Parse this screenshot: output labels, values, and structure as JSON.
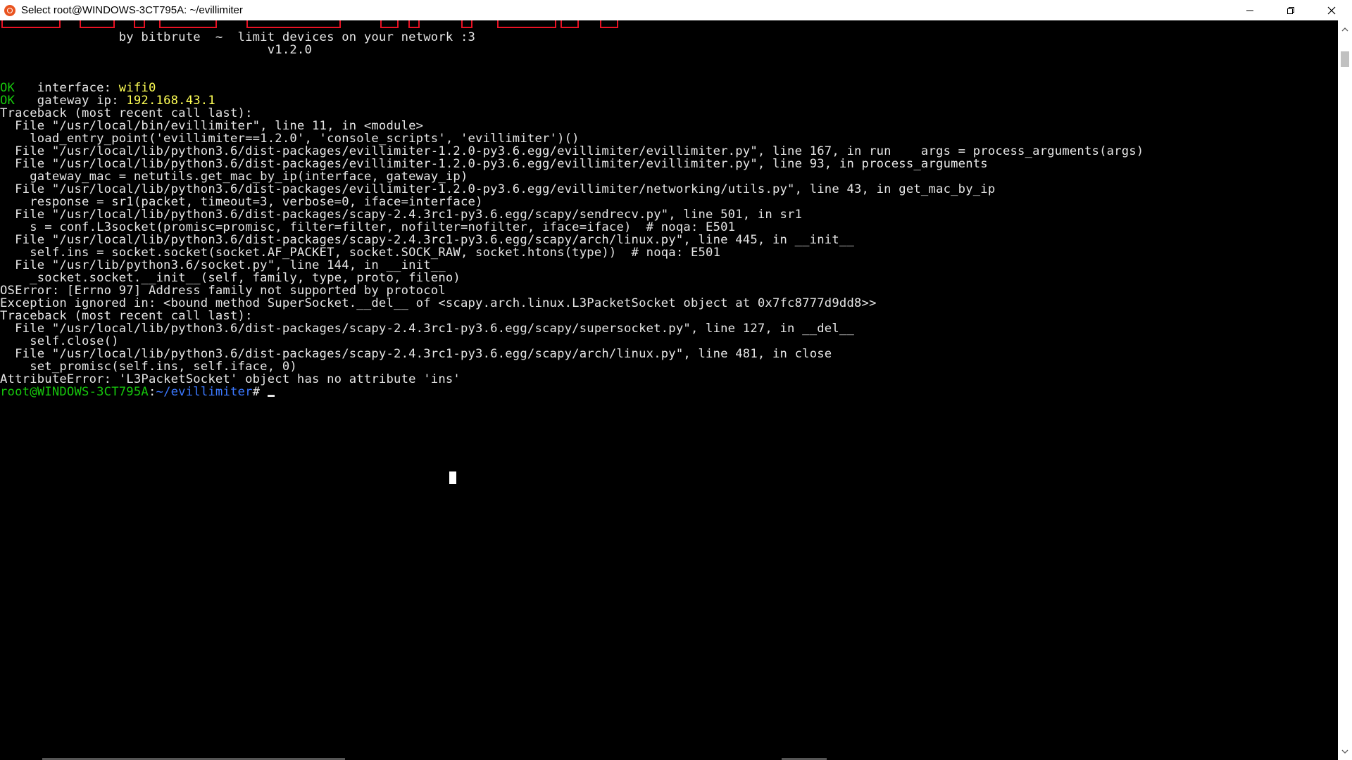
{
  "window": {
    "title": "Select root@WINDOWS-3CT795A: ~/evillimiter",
    "minimize_label": "",
    "maximize_label": "",
    "close_label": ""
  },
  "terminal": {
    "lines": [
      {
        "text": "                by bitbrute  ~  limit devices on your network :3"
      },
      {
        "text": "                                    v1.2.0"
      },
      {
        "text": ""
      },
      {
        "text": ""
      },
      {
        "status": "OK",
        "label": "   interface: ",
        "value": "wifi0"
      },
      {
        "status": "OK",
        "label": "   gateway ip: ",
        "value": "192.168.43.1"
      },
      {
        "text": "Traceback (most recent call last):"
      },
      {
        "text": "  File \"/usr/local/bin/evillimiter\", line 11, in <module>"
      },
      {
        "text": "    load_entry_point('evillimiter==1.2.0', 'console_scripts', 'evillimiter')()"
      },
      {
        "text": "  File \"/usr/local/lib/python3.6/dist-packages/evillimiter-1.2.0-py3.6.egg/evillimiter/evillimiter.py\", line 167, in run    args = process_arguments(args)"
      },
      {
        "text": "  File \"/usr/local/lib/python3.6/dist-packages/evillimiter-1.2.0-py3.6.egg/evillimiter/evillimiter.py\", line 93, in process_arguments"
      },
      {
        "text": "    gateway_mac = netutils.get_mac_by_ip(interface, gateway_ip)"
      },
      {
        "text": "  File \"/usr/local/lib/python3.6/dist-packages/evillimiter-1.2.0-py3.6.egg/evillimiter/networking/utils.py\", line 43, in get_mac_by_ip"
      },
      {
        "text": "    response = sr1(packet, timeout=3, verbose=0, iface=interface)"
      },
      {
        "text": "  File \"/usr/local/lib/python3.6/dist-packages/scapy-2.4.3rc1-py3.6.egg/scapy/sendrecv.py\", line 501, in sr1"
      },
      {
        "text": "    s = conf.L3socket(promisc=promisc, filter=filter, nofilter=nofilter, iface=iface)  # noqa: E501"
      },
      {
        "text": "  File \"/usr/local/lib/python3.6/dist-packages/scapy-2.4.3rc1-py3.6.egg/scapy/arch/linux.py\", line 445, in __init__"
      },
      {
        "text": "    self.ins = socket.socket(socket.AF_PACKET, socket.SOCK_RAW, socket.htons(type))  # noqa: E501"
      },
      {
        "text": "  File \"/usr/lib/python3.6/socket.py\", line 144, in __init__"
      },
      {
        "text": "    _socket.socket.__init__(self, family, type, proto, fileno)"
      },
      {
        "text": "OSError: [Errno 97] Address family not supported by protocol"
      },
      {
        "text": "Exception ignored in: <bound method SuperSocket.__del__ of <scapy.arch.linux.L3PacketSocket object at 0x7fc8777d9dd8>>"
      },
      {
        "text": "Traceback (most recent call last):"
      },
      {
        "text": "  File \"/usr/local/lib/python3.6/dist-packages/scapy-2.4.3rc1-py3.6.egg/scapy/supersocket.py\", line 127, in __del__"
      },
      {
        "text": "    self.close()"
      },
      {
        "text": "  File \"/usr/local/lib/python3.6/dist-packages/scapy-2.4.3rc1-py3.6.egg/scapy/arch/linux.py\", line 481, in close"
      },
      {
        "text": "    set_promisc(self.ins, self.iface, 0)"
      },
      {
        "text": "AttributeError: 'L3PacketSocket' object has no attribute 'ins'"
      }
    ],
    "prompt": {
      "user_host": "root@WINDOWS-3CT795A",
      "separator": ":",
      "path": "~/evillimiter",
      "symbol": "# "
    }
  },
  "colors": {
    "background": "#000000",
    "text": "#e6e6e6",
    "ok": "#16c60c",
    "highlight": "#ffff55",
    "path": "#3b78ff",
    "banner": "#e81123"
  }
}
